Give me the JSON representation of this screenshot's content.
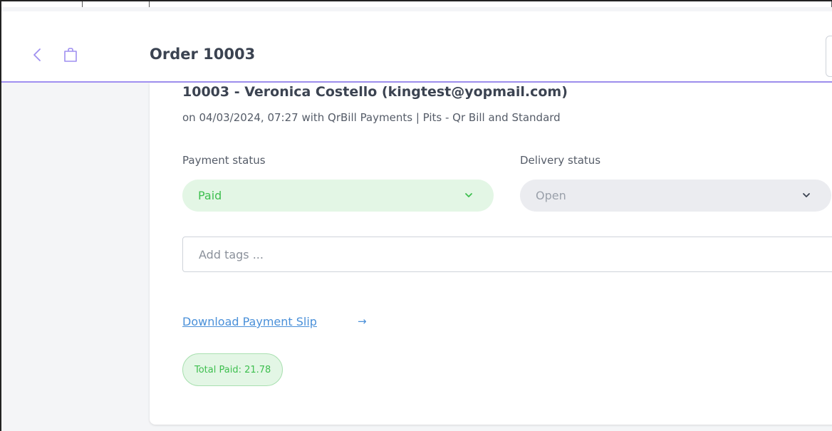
{
  "header": {
    "title": "Order 10003",
    "back_icon": "chevron-left-icon",
    "bag_icon": "shopping-bag-icon"
  },
  "order": {
    "heading": "10003 - Veronica Costello (kingtest@yopmail.com)",
    "subtitle": "on 04/03/2024, 07:27 with QrBill Payments | Pits - Qr Bill and Standard"
  },
  "payment": {
    "label": "Payment status",
    "value": "Paid",
    "color": "#3ebf4f"
  },
  "delivery": {
    "label": "Delivery status",
    "value": "Open"
  },
  "tags": {
    "placeholder": "Add tags ..."
  },
  "download": {
    "label": "Download Payment Slip",
    "arrow": "→"
  },
  "total": {
    "label": "Total Paid: 21.78"
  },
  "colors": {
    "accent": "#9f8ff0",
    "link": "#4a90d9",
    "success": "#3ebf4f"
  }
}
